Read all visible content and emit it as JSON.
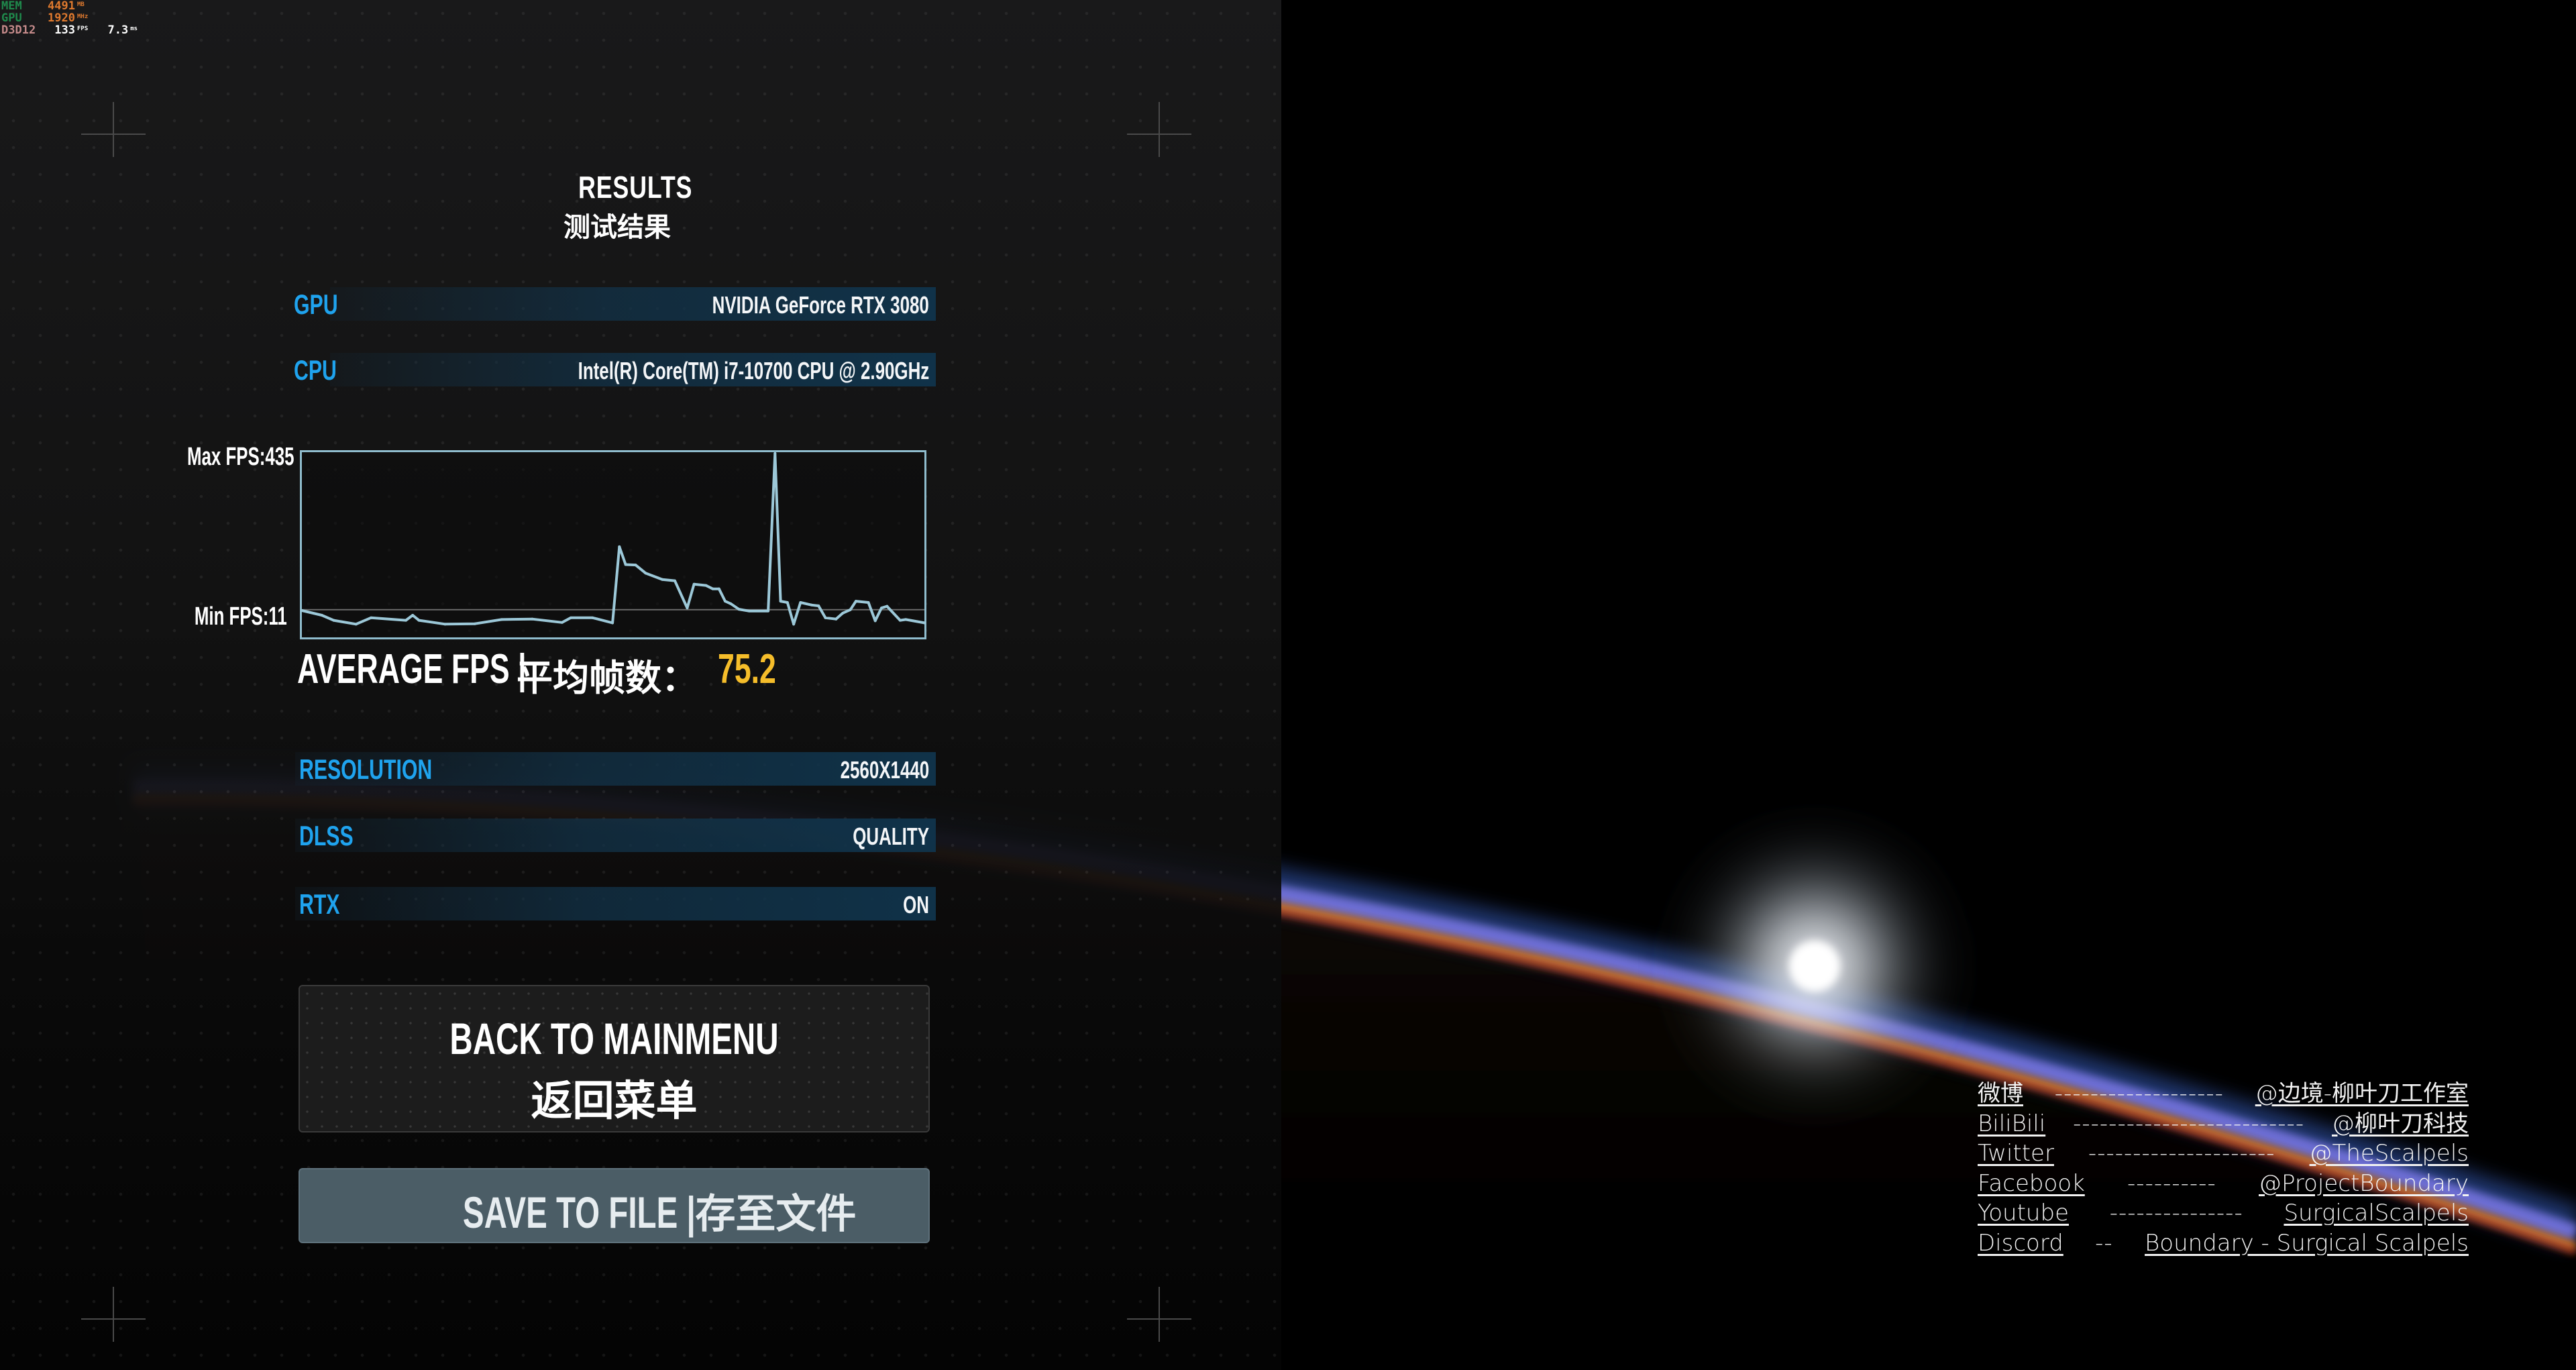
{
  "hud": {
    "rows": [
      {
        "key": "MEM",
        "value": "4491",
        "unit": "MB",
        "key_color": "#1f8a4c",
        "value_color": "#e07a2e"
      },
      {
        "key": "GPU",
        "value": "1920",
        "unit": "MHz",
        "key_color": "#1f8a4c",
        "value_color": "#e07a2e"
      },
      {
        "key": "D3D12",
        "value": "133",
        "unit": "FPS",
        "extra_value": "7.3",
        "extra_unit": "ms",
        "key_color": "#c48a8a",
        "value_color": "#ffffff"
      }
    ]
  },
  "results": {
    "title": "RESULTS",
    "title_cn": "测试结果"
  },
  "hardware": [
    {
      "label": "GPU",
      "value": "NVIDIA GeForce RTX 3080"
    },
    {
      "label": "CPU",
      "value": "Intel(R) Core(TM) i7-10700 CPU @ 2.90GHz"
    }
  ],
  "chart_data": {
    "type": "line",
    "title": "",
    "max_label": "Max FPS:435",
    "min_label": "Min FPS:11",
    "xlabel": "",
    "ylabel": "FPS",
    "ylim": [
      0,
      435
    ],
    "reference_line": 65,
    "grid": false,
    "series": [
      {
        "name": "FPS",
        "color": "#9cc8d8",
        "x": [
          0.0,
          0.032,
          0.051,
          0.087,
          0.111,
          0.167,
          0.178,
          0.188,
          0.23,
          0.278,
          0.321,
          0.37,
          0.418,
          0.432,
          0.467,
          0.499,
          0.51,
          0.52,
          0.536,
          0.552,
          0.579,
          0.599,
          0.619,
          0.63,
          0.649,
          0.66,
          0.67,
          0.68,
          0.689,
          0.702,
          0.718,
          0.749,
          0.76,
          0.769,
          0.78,
          0.79,
          0.801,
          0.819,
          0.83,
          0.841,
          0.858,
          0.869,
          0.881,
          0.89,
          0.91,
          0.921,
          0.931,
          0.94,
          0.961,
          0.97,
          1.0
        ],
        "values": [
          63,
          52,
          40,
          31,
          46,
          40,
          52,
          40,
          31,
          32,
          42,
          43,
          35,
          46,
          46,
          34,
          213,
          171,
          170,
          151,
          136,
          133,
          69,
          125,
          122,
          114,
          114,
          85,
          79,
          66,
          62,
          62,
          432,
          85,
          82,
          31,
          82,
          76,
          74,
          46,
          43,
          57,
          65,
          85,
          82,
          39,
          69,
          73,
          40,
          42,
          34
        ]
      }
    ]
  },
  "average": {
    "label": "AVERAGE FPS | ",
    "label_cn": "平均帧数：",
    "value": "75.2",
    "value_color": "#f5bd2a"
  },
  "settings": [
    {
      "label": "RESOLUTION",
      "value": "2560X1440"
    },
    {
      "label": "DLSS",
      "value": "QUALITY"
    },
    {
      "label": "RTX",
      "value": "ON"
    }
  ],
  "buttons": {
    "back_label": "BACK TO MAINMENU",
    "back_label_cn": "返回菜单",
    "save_label": "SAVE TO FILE | ",
    "save_label_cn": "存至文件"
  },
  "social": [
    {
      "platform": "微博",
      "dashes": "-------------------",
      "handle": "@边境-柳叶刀工作室"
    },
    {
      "platform": "BiliBili",
      "dashes": "--------------------------",
      "handle": "@柳叶刀科技"
    },
    {
      "platform": "Twitter",
      "dashes": "---------------------",
      "handle": "@TheScalpels"
    },
    {
      "platform": "Facebook",
      "dashes": "----------",
      "handle": "@ProjectBoundary"
    },
    {
      "platform": "Youtube",
      "dashes": "---------------",
      "handle": "SurgicalScalpels"
    },
    {
      "platform": "Discord",
      "dashes": "--",
      "handle": "Boundary - Surgical Scalpels"
    }
  ],
  "colors": {
    "accent_label": "#1fa3ee",
    "chart_line": "#9cc8d8",
    "save_button_bg": "#4b5d66"
  }
}
